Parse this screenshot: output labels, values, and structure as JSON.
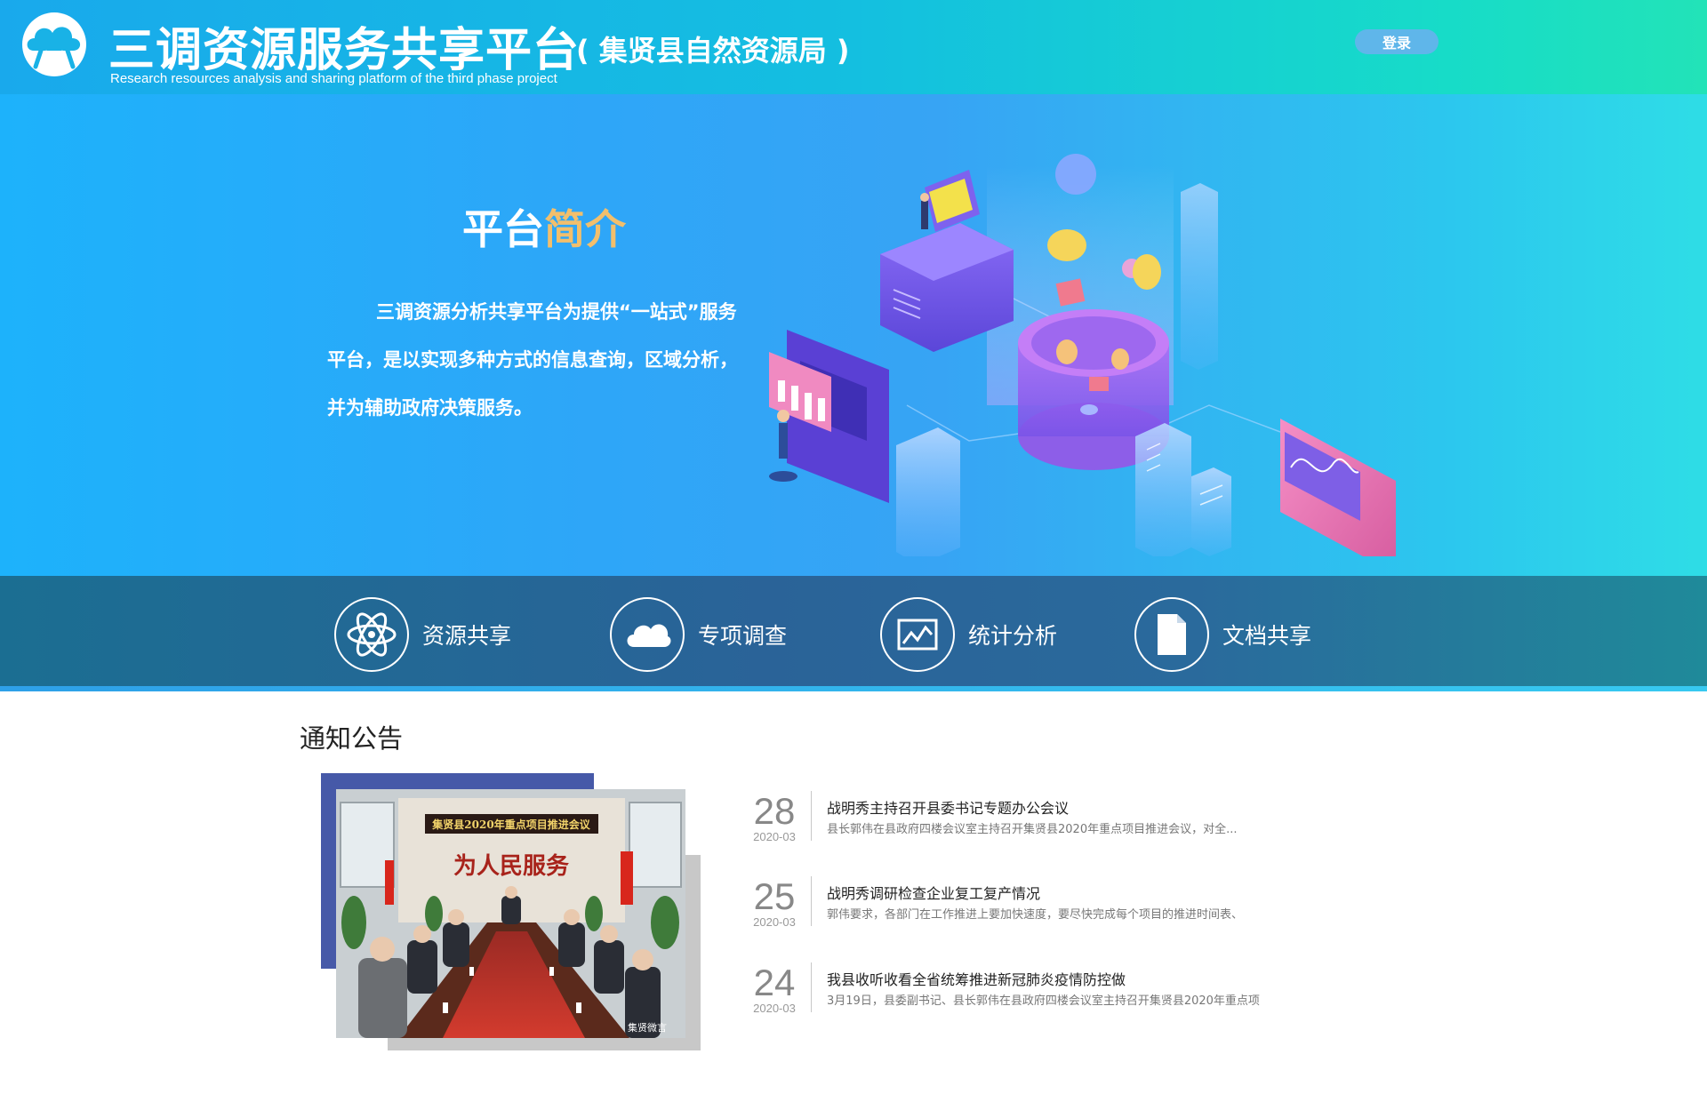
{
  "header": {
    "title": "三调资源服务共享平台",
    "subtitle": "( 集贤县自然资源局 )",
    "english": "Research resources analysis and sharing platform of the third phase project",
    "login_label": "登录"
  },
  "hero": {
    "title_part1": "平台",
    "title_part2": "简介",
    "lines": [
      "三调资源分析共享平台为提供“一站式”服务",
      "平台，是以实现多种方式的信息查询，区域分析，",
      "并为辅助政府决策服务。"
    ]
  },
  "features": [
    {
      "label": "资源共享",
      "icon": "atom-icon"
    },
    {
      "label": "专项调查",
      "icon": "cloud-icon"
    },
    {
      "label": "统计分析",
      "icon": "chart-icon"
    },
    {
      "label": "文档共享",
      "icon": "document-icon"
    }
  ],
  "notice": {
    "title": "通知公告",
    "photo": {
      "banner": "集贤县2020年重点项目推进会议",
      "calligraphy": "为人民服务",
      "watermark": "集贤微言"
    },
    "items": [
      {
        "day": "28",
        "month": "2020-03",
        "title": "战明秀主持召开县委书记专题办公会议",
        "summary": "县长郭伟在县政府四楼会议室主持召开集贤县2020年重点项目推进会议，对全..."
      },
      {
        "day": "25",
        "month": "2020-03",
        "title": "战明秀调研检查企业复工复产情况",
        "summary": "郭伟要求，各部门在工作推进上要加快速度，要尽快完成每个项目的推进时间表、"
      },
      {
        "day": "24",
        "month": "2020-03",
        "title": "我县收听收看全省统筹推进新冠肺炎疫情防控做",
        "summary": "3月19日，县委副书记、县长郭伟在县政府四楼会议室主持召开集贤县2020年重点项"
      }
    ]
  },
  "colors": {
    "header_start": "#19a9ec",
    "header_end": "#22e3b8",
    "hero_accent": "#f2bf6c",
    "feature_bar": "#2a6398"
  }
}
